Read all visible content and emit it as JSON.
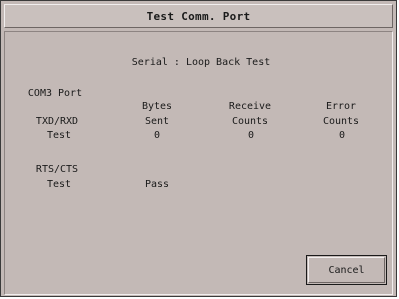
{
  "window": {
    "title": "Test Comm. Port"
  },
  "test": {
    "heading": "Serial : Loop Back Test",
    "port_label": "COM3 Port",
    "txd_rxd_label_line1": "TXD/RXD",
    "txd_rxd_label_line2": "Test",
    "columns": [
      {
        "line1": "Bytes",
        "line2": "Sent",
        "value": "0"
      },
      {
        "line1": "Receive",
        "line2": "Counts",
        "value": "0"
      },
      {
        "line1": "Error",
        "line2": "Counts",
        "value": "0"
      }
    ],
    "rts_cts_label_line1": "RTS/CTS",
    "rts_cts_label_line2": "Test",
    "rts_cts_result": "Pass"
  },
  "buttons": {
    "cancel_label": "Cancel"
  },
  "colors": {
    "background": "#c3b9b6",
    "text": "#1a1a1a"
  }
}
